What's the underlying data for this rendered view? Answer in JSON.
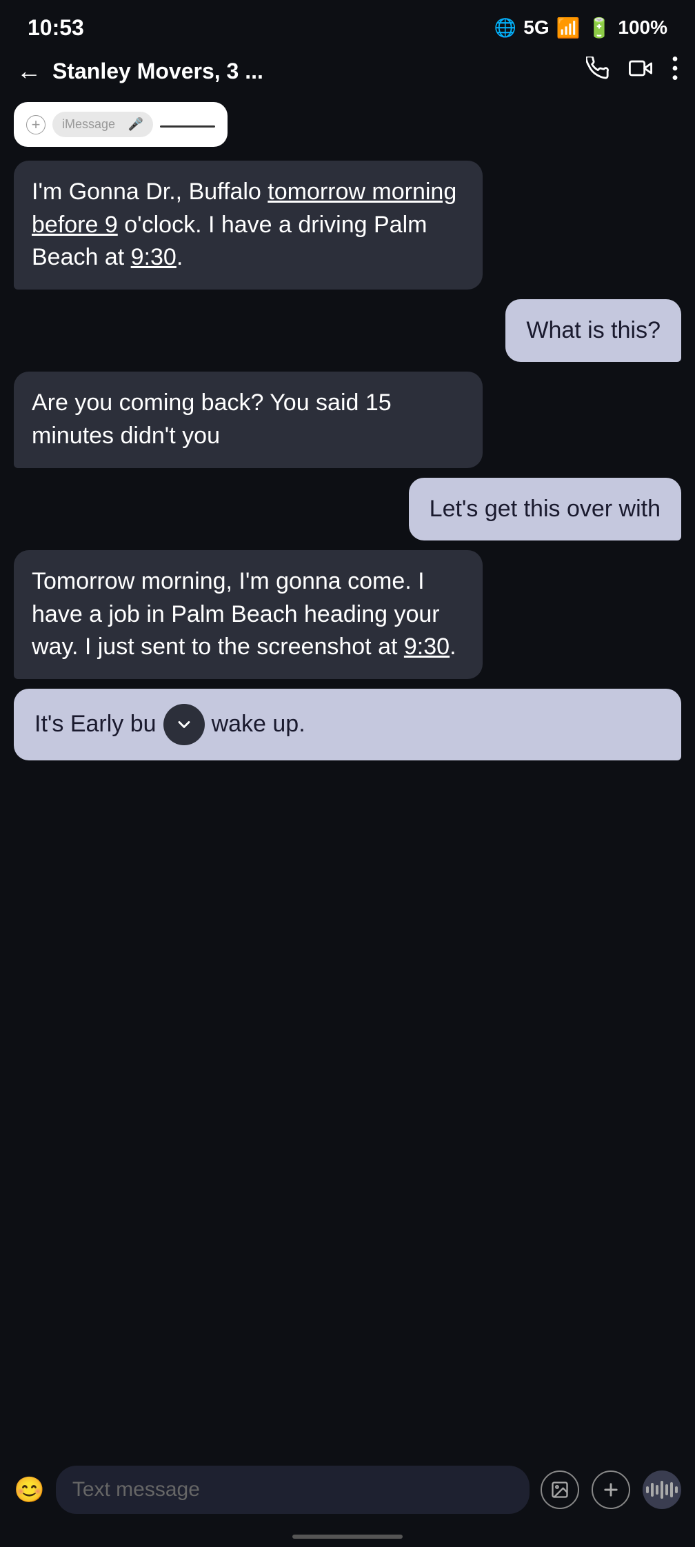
{
  "status": {
    "time": "10:53",
    "network": "5G",
    "battery": "100%"
  },
  "header": {
    "back_label": "←",
    "title": "Stanley Movers, 3 ...",
    "phone_icon": "phone",
    "video_icon": "video",
    "more_icon": "more"
  },
  "imessage_overlay": {
    "plus_icon": "+",
    "placeholder": "iMessage",
    "mic_icon": "🎤"
  },
  "messages": [
    {
      "id": "msg1",
      "type": "received",
      "text": "I'm Gonna Dr., Buffalo tomorrow morning before 9 o'clock. I have a driving Palm Beach at 9:30.",
      "underlines": [
        "tomorrow morning before 9",
        "9:30"
      ]
    },
    {
      "id": "msg2",
      "type": "sent",
      "text": "What is this?"
    },
    {
      "id": "msg3",
      "type": "received",
      "text": "Are you coming back? You said 15 minutes didn't you"
    },
    {
      "id": "msg4",
      "type": "sent",
      "text": "Let's get this over with"
    },
    {
      "id": "msg5",
      "type": "received",
      "text": "Tomorrow morning, I'm gonna come. I have a job in Palm Beach heading your way. I just sent to the screenshot at 9:30.",
      "underlines": [
        "9:30"
      ]
    },
    {
      "id": "msg6",
      "type": "sent_partial",
      "text_before": "It's Early bu",
      "text_after": "wake up."
    }
  ],
  "input": {
    "placeholder": "Text message",
    "emoji_icon": "😊"
  }
}
